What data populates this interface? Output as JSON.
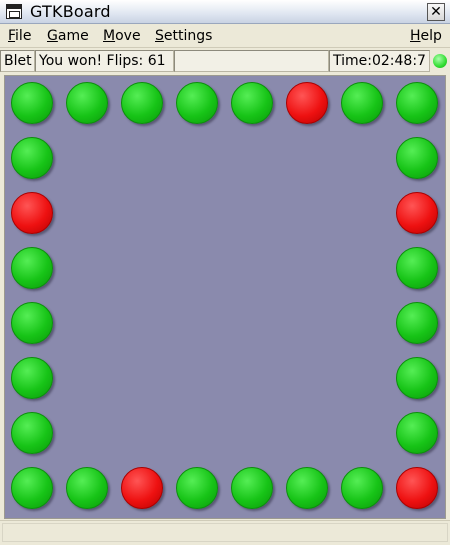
{
  "window": {
    "title": "GTKBoard",
    "close_glyph": "✕"
  },
  "menu": {
    "file": {
      "mnemonic": "F",
      "rest": "ile"
    },
    "game": {
      "mnemonic": "G",
      "rest": "ame"
    },
    "move": {
      "mnemonic": "M",
      "rest": "ove"
    },
    "settings": {
      "mnemonic": "S",
      "rest": "ettings"
    },
    "help": {
      "mnemonic": "H",
      "rest": "elp"
    }
  },
  "status": {
    "game_name": "Blet",
    "message": "You won! Flips: 61",
    "time": "Time:02:48:7",
    "indicator_color": "#33dd33"
  },
  "board": {
    "background": "#8a8aad",
    "cells": [
      [
        "green",
        "green",
        "green",
        "green",
        "green",
        "red",
        "green",
        "green"
      ],
      [
        "green",
        "",
        "",
        "",
        "",
        "",
        "",
        "green"
      ],
      [
        "red",
        "",
        "",
        "",
        "",
        "",
        "",
        "red"
      ],
      [
        "green",
        "",
        "",
        "",
        "",
        "",
        "",
        "green"
      ],
      [
        "green",
        "",
        "",
        "",
        "",
        "",
        "",
        "green"
      ],
      [
        "green",
        "",
        "",
        "",
        "",
        "",
        "",
        "green"
      ],
      [
        "green",
        "",
        "",
        "",
        "",
        "",
        "",
        "green"
      ],
      [
        "green",
        "green",
        "red",
        "green",
        "green",
        "green",
        "green",
        "red"
      ]
    ]
  }
}
